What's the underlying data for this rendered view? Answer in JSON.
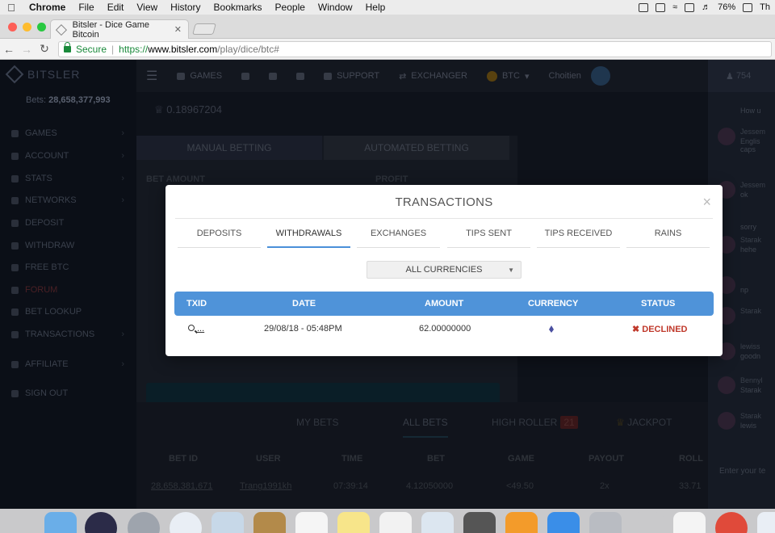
{
  "menubar": {
    "app": "Chrome",
    "menus": [
      "File",
      "Edit",
      "View",
      "History",
      "Bookmarks",
      "People",
      "Window",
      "Help"
    ],
    "battery": "76%",
    "user_initial": "Th"
  },
  "browser": {
    "tab_title": "Bitsler - Dice Game Bitcoin",
    "secure_label": "Secure",
    "url_proto": "https://",
    "url_host": "www.bitsler.com",
    "url_path": "/play/dice/btc#"
  },
  "site": {
    "logo": "BITSLER",
    "bets_label": "Bets:",
    "bets_count": "28,658,377,993",
    "sidebar": [
      "GAMES",
      "ACCOUNT",
      "STATS",
      "NETWORKS",
      "DEPOSIT",
      "WITHDRAW",
      "FREE BTC",
      "FORUM",
      "BET LOOKUP",
      "TRANSACTIONS",
      "AFFILIATE",
      "SIGN OUT"
    ],
    "topbar": {
      "games": "GAMES",
      "support": "SUPPORT",
      "exchanger": "EXCHANGER",
      "currency": "BTC",
      "username": "Choitien"
    },
    "balance": "0.18967204",
    "betting_tabs": [
      "MANUAL BETTING",
      "AUTOMATED BETTING"
    ],
    "bet_amount_label": "BET AMOUNT",
    "profit_label": "PROFIT",
    "bets_tabs": [
      "MY BETS",
      "ALL BETS",
      "HIGH ROLLER",
      "JACKPOT"
    ],
    "high_roller_count": "21",
    "bets_columns": [
      "BET ID",
      "USER",
      "TIME",
      "BET",
      "GAME",
      "PAYOUT",
      "ROLL"
    ],
    "bets_row": [
      "28,658,381,671",
      "Trang1991kh",
      "07:39:14",
      "4.12050000",
      "<49.50",
      "2x",
      "33.71"
    ]
  },
  "chat": {
    "online": "754",
    "messages": [
      {
        "name": "",
        "text": "How u"
      },
      {
        "name": "Jessem",
        "text": "Englis caps"
      },
      {
        "name": "Jessem",
        "text": "ok"
      },
      {
        "name": "",
        "text": "sorry"
      },
      {
        "name": "Starak",
        "text": "hehe"
      },
      {
        "name": "",
        "text": "np"
      },
      {
        "name": "Starak",
        "text": ""
      },
      {
        "name": "lewiss",
        "text": "goodn"
      },
      {
        "name": "Bennyl",
        "text": "Starak"
      },
      {
        "name": "Starak",
        "text": "lewis"
      }
    ],
    "input_placeholder": "Enter your te"
  },
  "modal": {
    "title": "TRANSACTIONS",
    "tabs": [
      "DEPOSITS",
      "WITHDRAWALS",
      "EXCHANGES",
      "TIPS SENT",
      "TIPS RECEIVED",
      "RAINS"
    ],
    "active_tab": "WITHDRAWALS",
    "currency_filter": "ALL CURRENCIES",
    "columns": [
      "TXID",
      "DATE",
      "AMOUNT",
      "CURRENCY",
      "STATUS"
    ],
    "rows": [
      {
        "txid": "...",
        "date": "29/08/18 - 05:48PM",
        "amount": "62.00000000",
        "currency_icon": "ethereum-icon",
        "status": "DECLINED"
      }
    ],
    "colors": {
      "header_bg": "#4f93d9",
      "declined": "#c0392b",
      "active_tab_underline": "#4a90d9"
    }
  }
}
